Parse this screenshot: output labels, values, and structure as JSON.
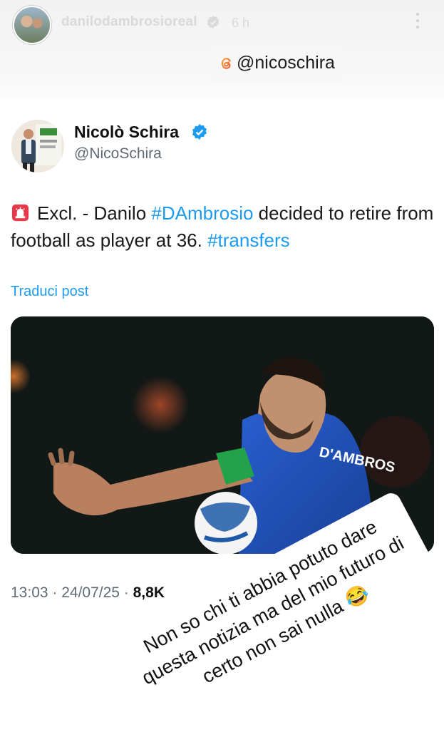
{
  "story": {
    "username": "danilodambrosioreal",
    "time_ago": "6 h",
    "mention": "@nicoschira"
  },
  "post": {
    "display_name": "Nicolò Schira",
    "handle": "@NicoSchira",
    "text_prefix": "Excl. - Danilo ",
    "hashtag1": "#DAmbrosio",
    "text_middle": " decided to retire from football as player at 36. ",
    "hashtag2": "#transfers",
    "translate": "Traduci post",
    "meta_time": "13:03 · 24/07/25 · ",
    "meta_views": "8,8K"
  },
  "image": {
    "jersey_text": "D'AMBROS"
  },
  "caption": {
    "text": "Non so chi ti abbia potuto dare questa notizia ma del mio futuro di certo non sai nulla 😂"
  },
  "colors": {
    "accent": "#1d9bf0",
    "jersey": "#1f4fb3"
  }
}
